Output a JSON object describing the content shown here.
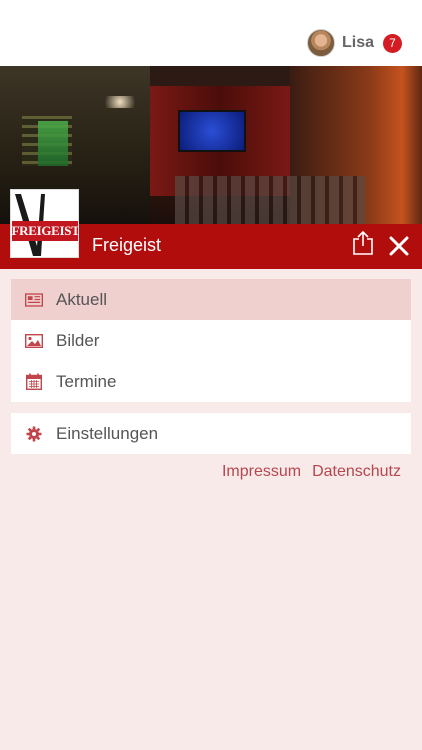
{
  "header": {
    "user_name": "Lisa",
    "notification_count": "7"
  },
  "club": {
    "name": "Freigeist",
    "logo_text": "FREIGEIST"
  },
  "menu": {
    "primary": [
      {
        "label": "Aktuell",
        "icon": "newspaper-icon",
        "active": true
      },
      {
        "label": "Bilder",
        "icon": "image-icon",
        "active": false
      },
      {
        "label": "Termine",
        "icon": "calendar-icon",
        "active": false
      }
    ],
    "secondary": [
      {
        "label": "Einstellungen",
        "icon": "gear-icon",
        "active": false
      }
    ]
  },
  "footer": {
    "impressum": "Impressum",
    "datenschutz": "Datenschutz"
  },
  "colors": {
    "brand_red": "#b10d0d",
    "background": "#f9eaea",
    "active_item": "#f0cfcf",
    "badge": "#d31c24",
    "link": "#b5474e"
  }
}
